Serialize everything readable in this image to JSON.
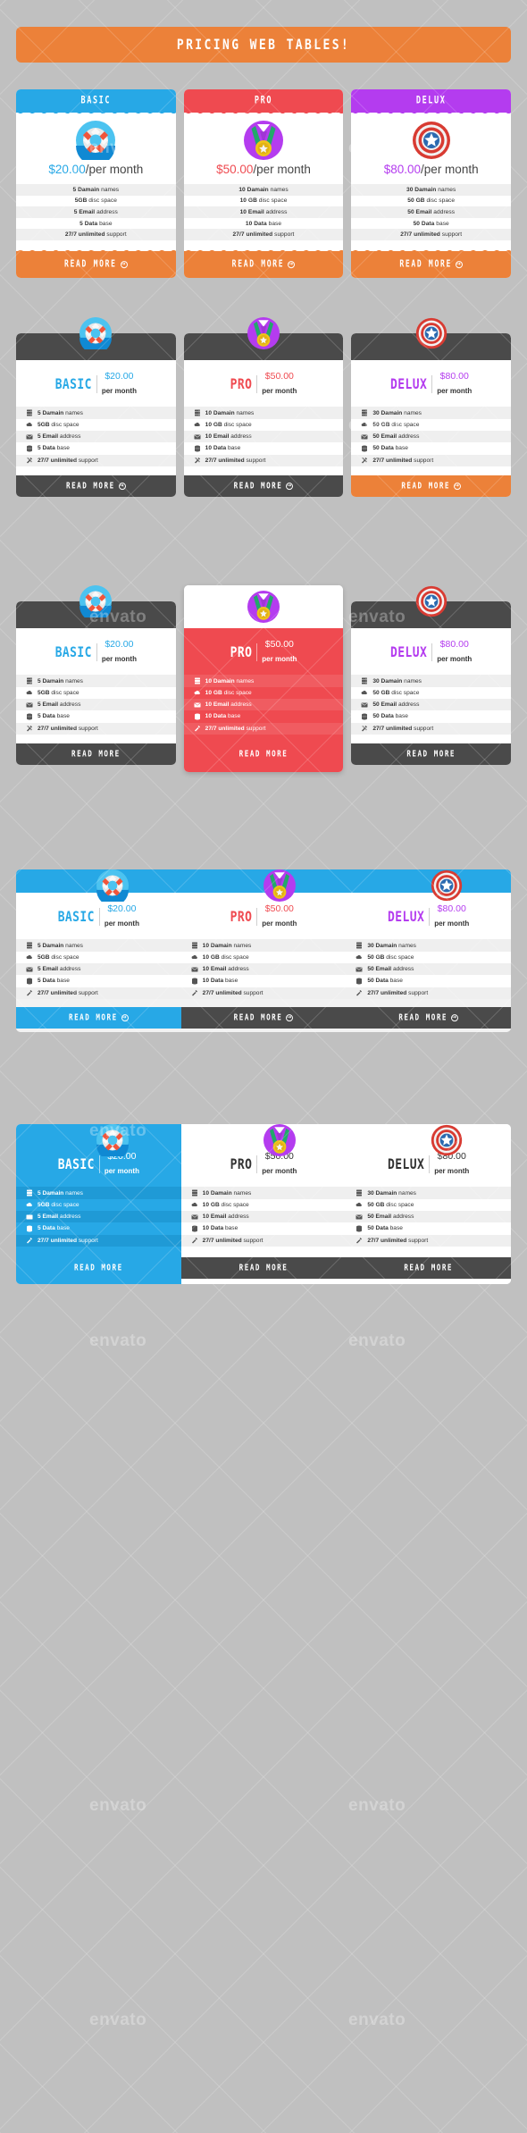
{
  "banner": {
    "title": "PRICING  WEB  TABLES!"
  },
  "colors": {
    "background": "#c0c0c0",
    "orange": "#ec8139",
    "basic_blue": "#27a8e6",
    "pro_red": "#ef4a50",
    "delux_purple": "#b43cef",
    "dark_gray": "#4a4a4a",
    "row_alt": "#efefef",
    "card_white": "#ffffff"
  },
  "read_more_label": "READ  MORE",
  "arrow_glyph": "→",
  "plans": [
    {
      "name": "BASIC",
      "icon": "lifebuoy-icon",
      "accent": "#27a8e6",
      "price_amount": "$20.00",
      "price_period": "/per month",
      "price_period_two_line": "per month",
      "features": [
        {
          "strong": "5 Damain",
          "rest": " names",
          "icon": "server-icon"
        },
        {
          "strong": "5GB",
          "rest": " disc space",
          "icon": "cloud-icon"
        },
        {
          "strong": "5 Email",
          "rest": " address",
          "icon": "envelope-icon"
        },
        {
          "strong": "5 Data",
          "rest": " base",
          "icon": "database-icon"
        },
        {
          "strong": "27/7 unlimited",
          "rest": " support",
          "icon": "tools-icon"
        }
      ]
    },
    {
      "name": "PRO",
      "icon": "medal-icon",
      "accent": "#ef4a50",
      "price_amount": "$50.00",
      "price_period": "/per month",
      "price_period_two_line": "per month",
      "features": [
        {
          "strong": "10 Damain",
          "rest": " names",
          "icon": "server-icon"
        },
        {
          "strong": "10 GB",
          "rest": " disc space",
          "icon": "cloud-icon"
        },
        {
          "strong": "10 Email",
          "rest": " address",
          "icon": "envelope-icon"
        },
        {
          "strong": "10 Data",
          "rest": " base",
          "icon": "database-icon"
        },
        {
          "strong": "27/7 unlimited",
          "rest": " support",
          "icon": "tools-icon"
        }
      ]
    },
    {
      "name": "DELUX",
      "icon": "shield-star-icon",
      "accent": "#b43cef",
      "price_amount": "$80.00",
      "price_period": "/per month",
      "price_period_two_line": "per month",
      "features": [
        {
          "strong": "30 Damain",
          "rest": " names",
          "icon": "server-icon"
        },
        {
          "strong": "50 GB",
          "rest": " disc space",
          "icon": "cloud-icon"
        },
        {
          "strong": "50 Email",
          "rest": " address",
          "icon": "envelope-icon"
        },
        {
          "strong": "50 Data",
          "rest": " base",
          "icon": "database-icon"
        },
        {
          "strong": "27/7 unlimited",
          "rest": " support",
          "icon": "tools-icon"
        }
      ]
    }
  ],
  "watermarks": [
    "envato",
    "envato",
    "envato",
    "envato",
    "envato",
    "envato",
    "envato",
    "envato"
  ]
}
